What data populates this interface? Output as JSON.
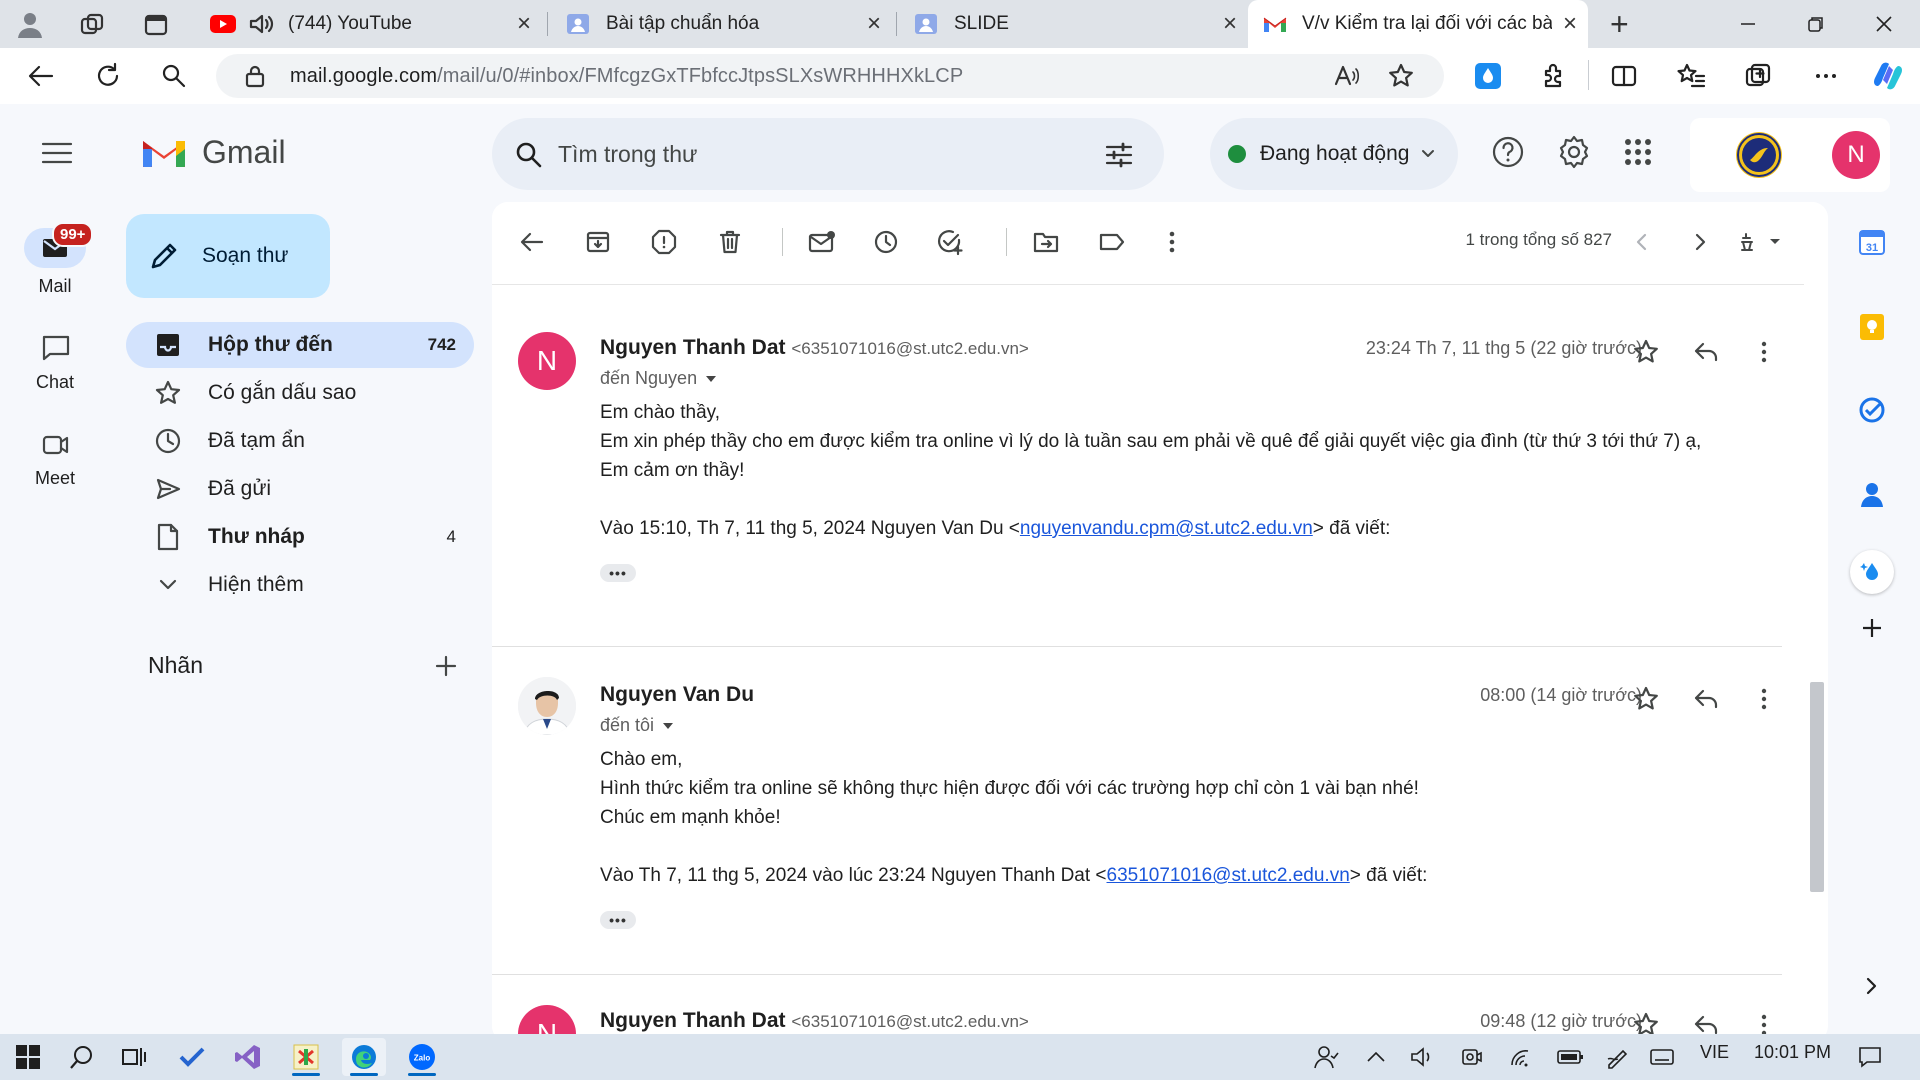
{
  "browser": {
    "tabs": [
      {
        "title": "(744) YouTube",
        "icon": "youtube-icon"
      },
      {
        "title": "Bài tập chuẩn hóa",
        "icon": "slides-icon"
      },
      {
        "title": "SLIDE",
        "icon": "slides-icon"
      },
      {
        "title": "V/v Kiểm tra lại đối với các bài l",
        "icon": "gmail-icon",
        "active": true
      }
    ],
    "new_tab": "+",
    "url_host": "mail.google.com",
    "url_path": "/mail/u/0/#inbox/FMfcgzGxTFbfccJtpsSLXsWRHHHXkLCP"
  },
  "gmail": {
    "brand": "Gmail",
    "search_placeholder": "Tìm trong thư",
    "status": "Đang hoạt động",
    "profile_initial": "N",
    "rail": {
      "mail_label": "Mail",
      "mail_badge": "99+",
      "chat_label": "Chat",
      "meet_label": "Meet"
    },
    "compose_label": "Soạn thư",
    "nav": [
      {
        "label": "Hộp thư đến",
        "count": "742",
        "icon": "inbox-icon"
      },
      {
        "label": "Có gắn dấu sao",
        "count": "",
        "icon": "star-icon"
      },
      {
        "label": "Đã tạm ẩn",
        "count": "",
        "icon": "clock-icon"
      },
      {
        "label": "Đã gửi",
        "count": "",
        "icon": "send-icon"
      },
      {
        "label": "Thư nháp",
        "count": "4",
        "icon": "draft-icon"
      },
      {
        "label": "Hiện thêm",
        "count": "",
        "icon": "chevron-down-icon"
      }
    ],
    "labels_heading": "Nhãn",
    "pagination": "1 trong tổng số 827",
    "messages": [
      {
        "avatar": "N",
        "sender": "Nguyen Thanh Dat",
        "email": "<6351071016@st.utc2.edu.vn>",
        "to": "đến Nguyen",
        "time": "23:24 Th 7, 11 thg 5 (22 giờ trước)",
        "lines": [
          "Em chào thầy,",
          "Em xin phép thầy cho em được kiểm tra online vì lý do là tuần sau em phải về quê để giải quyết việc gia đình (từ thứ 3 tới thứ 7) ạ,",
          "Em cảm ơn thầy!"
        ],
        "quote_prefix": "Vào 15:10, Th 7, 11 thg 5, 2024 Nguyen Van Du <",
        "quote_link": "nguyenvandu.cpm@st.utc2.edu.vn",
        "quote_suffix": "> đã viết:"
      },
      {
        "avatar": "",
        "sender": "Nguyen Van Du",
        "email": "",
        "to": "đến tôi",
        "time": "08:00 (14 giờ trước)",
        "lines": [
          "Chào em,",
          "Hình thức kiểm tra online sẽ không thực hiện được đối với các trường hợp chỉ còn 1 vài bạn nhé!",
          "Chúc em mạnh khỏe!"
        ],
        "quote_prefix": "Vào Th 7, 11 thg 5, 2024 vào lúc 23:24 Nguyen Thanh Dat <",
        "quote_link": "6351071016@st.utc2.edu.vn",
        "quote_suffix": "> đã viết:"
      },
      {
        "avatar": "N",
        "sender": "Nguyen Thanh Dat",
        "email": "<6351071016@st.utc2.edu.vn>",
        "time": "09:48 (12 giờ trước)"
      }
    ],
    "ellipsis": "•••"
  },
  "taskbar": {
    "language": "VIE",
    "clock": "10:01 PM"
  },
  "colors": {
    "accent": "#0b57d0",
    "active_nav": "#d3e3fd",
    "compose": "#c2e7ff",
    "avatar": "#e5336c",
    "status_dot": "#1e8e3e",
    "badge": "#c5221f"
  }
}
